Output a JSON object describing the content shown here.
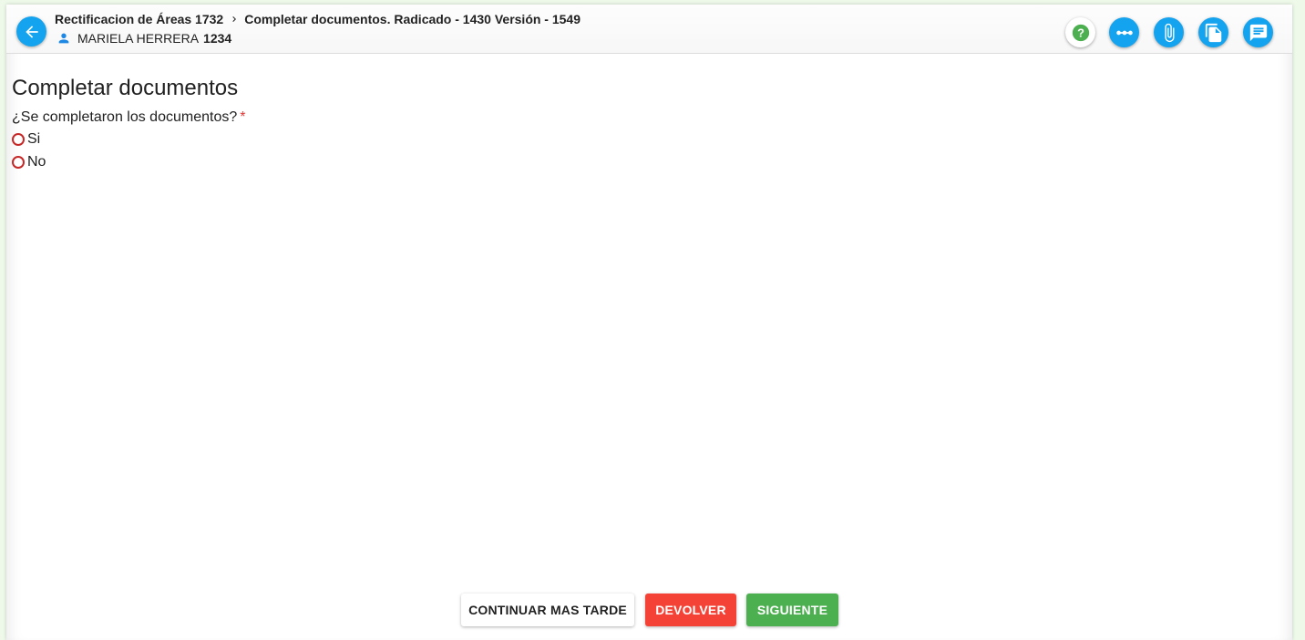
{
  "header": {
    "breadcrumb": {
      "process": "Rectificacion de Áreas 1732",
      "step": "Completar documentos. Radicado - 1430 Versión - 1549"
    },
    "user": {
      "name": "MARIELA HERRERA",
      "id": "1234"
    },
    "icons": {
      "back": "arrow-left-icon",
      "user": "person-icon",
      "separator": "chevron-right-icon"
    },
    "toolbar": [
      {
        "name": "help-button",
        "icon": "question-icon",
        "color": "#4caf50"
      },
      {
        "name": "flow-button",
        "icon": "timeline-dots-icon",
        "color": "#14a3ee"
      },
      {
        "name": "attachments-button",
        "icon": "paperclip-icon",
        "color": "#14a3ee"
      },
      {
        "name": "documents-button",
        "icon": "copy-document-icon",
        "color": "#14a3ee"
      },
      {
        "name": "comments-button",
        "icon": "comment-icon",
        "color": "#14a3ee"
      }
    ]
  },
  "form": {
    "title": "Completar documentos",
    "question": "¿Se completaron los documentos?",
    "required_mark": "*",
    "options": [
      "Si",
      "No"
    ]
  },
  "actions": {
    "later": "CONTINUAR MAS TARDE",
    "return": "DEVOLVER",
    "next": "SIGUIENTE"
  },
  "colors": {
    "primary": "#14a3ee",
    "danger": "#f44336",
    "success": "#4caf50",
    "radio_border": "#c62828"
  }
}
